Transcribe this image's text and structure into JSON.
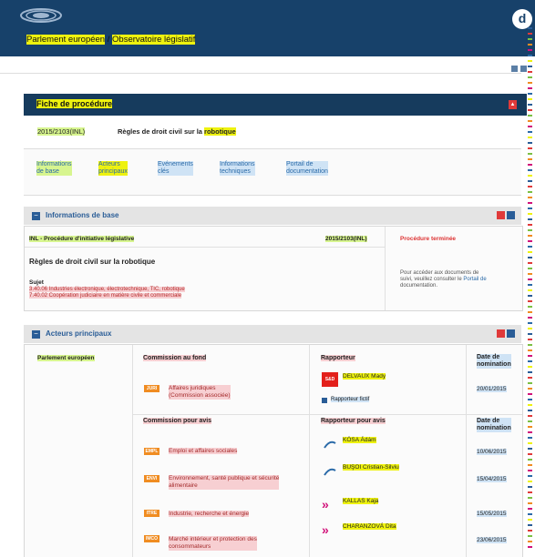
{
  "header": {
    "title_part1": "Parlement européen",
    "title_sep": " / ",
    "title_part2": "Observatoire législatif",
    "brand_letter": "d"
  },
  "fiche": {
    "heading": "Fiche de procédure",
    "reference": "2015/2103(INL)",
    "title_prefix": "Règles de droit civil sur la ",
    "title_hl": "robotique"
  },
  "tabs": [
    {
      "line1": "Informations",
      "line2": "de base"
    },
    {
      "line1": "Acteurs",
      "line2": "principaux"
    },
    {
      "line1": "Evénements",
      "line2": "clés"
    },
    {
      "line1": "Informations",
      "line2": "techniques"
    },
    {
      "line1": "Portail de",
      "line2": "documentation"
    }
  ],
  "basic_info": {
    "section_title": "Informations de base",
    "procedure_type": "INL - Procédure d'initiative législative",
    "reference": "2015/2103(INL)",
    "status": "Procédure terminée",
    "title": "Règles de droit civil sur la robotique",
    "subject_label": "Sujet",
    "subjects": [
      "3.40.06 Industries électronique, électrotechnique, TIC, robotique",
      "7.40.02 Coopération judiciaire en matière civile et commerciale"
    ],
    "portal_note_1": "Pour accéder aux documents de",
    "portal_note_2": "suivi, veuillez consulter le ",
    "portal_link": "Portail de",
    "portal_note_3": "documentation."
  },
  "actors": {
    "section_title": "Acteurs principaux",
    "institution": "Parlement européen",
    "col_committee_fond": "Commission au fond",
    "col_rapporteur": "Rapporteur",
    "col_date": "Date de",
    "col_date2": "nomination",
    "col_committee_avis": "Commission pour avis",
    "col_rapporteur_avis": "Rapporteur pour avis",
    "lead": {
      "badge": "JURI",
      "name_1": "Affaires juridiques",
      "name_2": "(Commission associée)",
      "rapporteur": "DELVAUX Mady",
      "shadow": "Rapporteur fictif",
      "date": "20/01/2015",
      "group_logo": "S&D"
    },
    "opinions": [
      {
        "badge": "EMPL",
        "name_1": "Emploi et affaires sociales",
        "name_2": "",
        "rapporteur": "KÓSA Ádám",
        "date": "10/06/2015",
        "logo": "epp"
      },
      {
        "badge": "ENVI",
        "name_1": "Environnement, santé publique et sécurité",
        "name_2": "alimentaire",
        "rapporteur": "BUŞOI Cristian-Silviu",
        "date": "15/04/2015",
        "logo": "epp"
      },
      {
        "badge": "ITRE",
        "name_1": "Industrie, recherche et énergie",
        "name_2": "",
        "rapporteur": "KALLAS Kaja",
        "date": "15/05/2015",
        "logo": "alde"
      },
      {
        "badge": "IMCO",
        "name_1": "Marché intérieur et protection des",
        "name_2": "consommateurs",
        "rapporteur": "CHARANZOVÁ Dita",
        "date": "23/06/2015",
        "logo": "alde"
      }
    ]
  },
  "colors": {
    "header_bg": "#17416a",
    "highlight_yellow": "#eef20f",
    "highlight_green": "#d7f58f",
    "highlight_blue": "#cfe3f5",
    "highlight_pink": "#f7cfd2"
  }
}
